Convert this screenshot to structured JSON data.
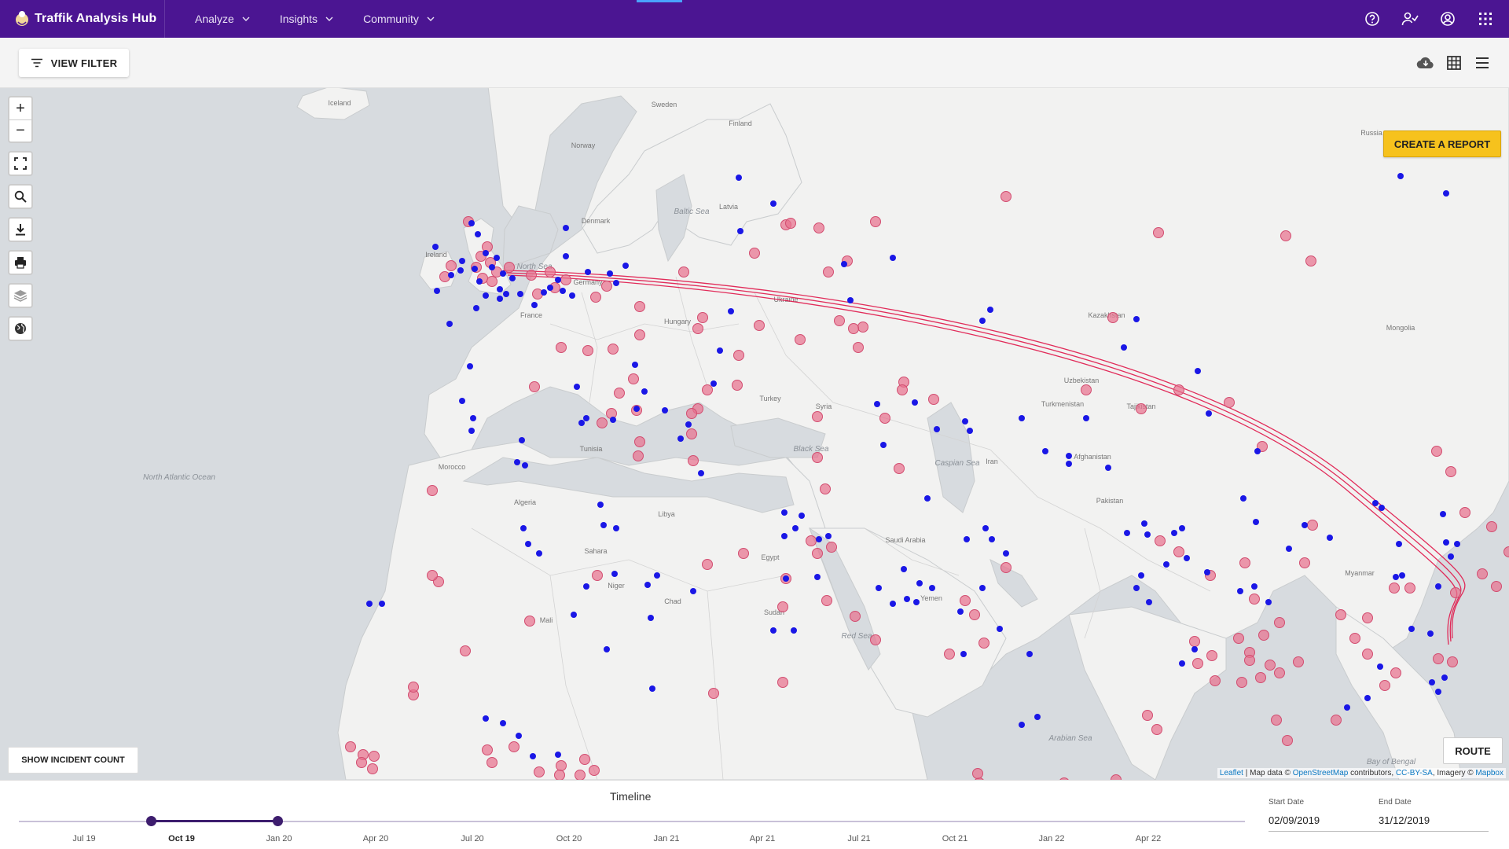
{
  "app": {
    "title": "Traffik Analysis Hub",
    "nav": [
      {
        "label": "Analyze"
      },
      {
        "label": "Insights"
      },
      {
        "label": "Community"
      }
    ],
    "top_icons": [
      "help-icon",
      "user-share-icon",
      "account-icon",
      "apps-grid-icon"
    ],
    "brand_color": "#4b1592"
  },
  "toolbar": {
    "view_filter_label": "VIEW FILTER",
    "right_icons": [
      "cloud-download-icon",
      "grid-view-icon",
      "list-view-icon"
    ]
  },
  "map": {
    "create_report_label": "CREATE A REPORT",
    "show_incident_label": "SHOW INCIDENT COUNT",
    "route_label": "ROUTE",
    "controls": [
      "zoom-in",
      "zoom-out",
      "fullscreen",
      "search",
      "download",
      "print",
      "layers",
      "globe"
    ],
    "zoom_in_symbol": "+",
    "zoom_out_symbol": "−",
    "attribution": {
      "leaflet": "Leaflet",
      "sep1": " | Map data © ",
      "osm": "OpenStreetMap",
      "sep2": " contributors, ",
      "license": "CC-BY-SA",
      "sep3": ", Imagery © ",
      "mapbox": "Mapbox"
    },
    "place_labels": [
      {
        "name": "Iceland"
      },
      {
        "name": "Sweden"
      },
      {
        "name": "Finland"
      },
      {
        "name": "Norway"
      },
      {
        "name": "Denmark"
      },
      {
        "name": "Latvia"
      },
      {
        "name": "Russia"
      },
      {
        "name": "Ireland"
      },
      {
        "name": "France"
      },
      {
        "name": "Germany"
      },
      {
        "name": "Hungary"
      },
      {
        "name": "Ukraine"
      },
      {
        "name": "Kazakhstan"
      },
      {
        "name": "Mongolia"
      },
      {
        "name": "Uzbekistan"
      },
      {
        "name": "Turkmenistan"
      },
      {
        "name": "Tajikistan"
      },
      {
        "name": "Afghanistan"
      },
      {
        "name": "Iran"
      },
      {
        "name": "Pakistan"
      },
      {
        "name": "Saudi Arabia"
      },
      {
        "name": "Yemen"
      },
      {
        "name": "Egypt"
      },
      {
        "name": "Libya"
      },
      {
        "name": "Algeria"
      },
      {
        "name": "Morocco"
      },
      {
        "name": "Tunisia"
      },
      {
        "name": "Sahara"
      },
      {
        "name": "Niger"
      },
      {
        "name": "Chad"
      },
      {
        "name": "Sudan"
      },
      {
        "name": "Mali"
      },
      {
        "name": "Myanmar"
      },
      {
        "name": "Syria"
      },
      {
        "name": "Turkey"
      }
    ],
    "sea_labels": [
      {
        "name": "North Atlantic Ocean"
      },
      {
        "name": "North Sea"
      },
      {
        "name": "Baltic Sea"
      },
      {
        "name": "Black Sea"
      },
      {
        "name": "Caspian Sea"
      },
      {
        "name": "Red Sea"
      },
      {
        "name": "Arabian Sea"
      },
      {
        "name": "Bay of Bengal"
      }
    ],
    "incident_colors": {
      "pink": "#e8718f",
      "blue": "#1a17e6",
      "route": "#e0174a"
    }
  },
  "timeline": {
    "title": "Timeline",
    "ticks": [
      {
        "label": "Jul 19"
      },
      {
        "label": "Oct 19"
      },
      {
        "label": "Jan 20"
      },
      {
        "label": "Apr 20"
      },
      {
        "label": "Jul 20"
      },
      {
        "label": "Oct 20"
      },
      {
        "label": "Jan 21"
      },
      {
        "label": "Apr 21"
      },
      {
        "label": "Jul 21"
      },
      {
        "label": "Oct 21"
      },
      {
        "label": "Jan 22"
      },
      {
        "label": "Apr 22"
      }
    ],
    "start_label": "Start Date",
    "start_value": "02/09/2019",
    "end_label": "End Date",
    "end_value": "31/12/2019"
  }
}
